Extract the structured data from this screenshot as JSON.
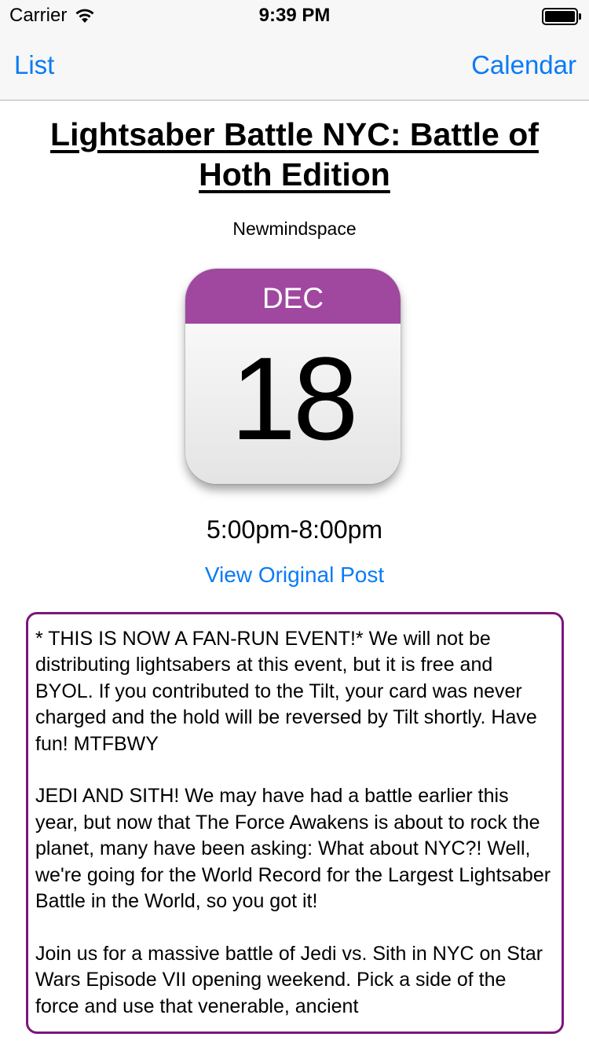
{
  "status_bar": {
    "carrier": "Carrier",
    "time": "9:39 PM",
    "wifi_icon": "wifi-icon",
    "battery_icon": "battery-icon"
  },
  "nav": {
    "left_label": "List",
    "right_label": "Calendar"
  },
  "event": {
    "title": "Lightsaber Battle NYC: Battle of Hoth Edition",
    "venue": "Newmindspace",
    "month": "DEC",
    "day": "18",
    "time": "5:00pm-8:00pm",
    "link_label": "View Original Post",
    "description": [
      "* THIS IS NOW A FAN-RUN EVENT!* We will not be distributing lightsabers at this event, but it is free and BYOL. If you contributed to the Tilt, your card was never charged and the hold will be reversed by Tilt shortly. Have fun! MTFBWY",
      "JEDI AND SITH! We may have had a battle earlier this year, but now that The Force Awakens is about to rock the planet, many have been asking: What about NYC?!  Well, we're going for the World Record for the Largest Lightsaber Battle in the World, so you got it!",
      "Join us for a massive battle of Jedi vs. Sith in NYC on Star Wars Episode VII opening weekend. Pick a side of the force and use that venerable, ancient"
    ]
  },
  "colors": {
    "accent_blue": "#0a7bf5",
    "calendar_header": "#a047a0",
    "description_border": "#7b167b"
  }
}
